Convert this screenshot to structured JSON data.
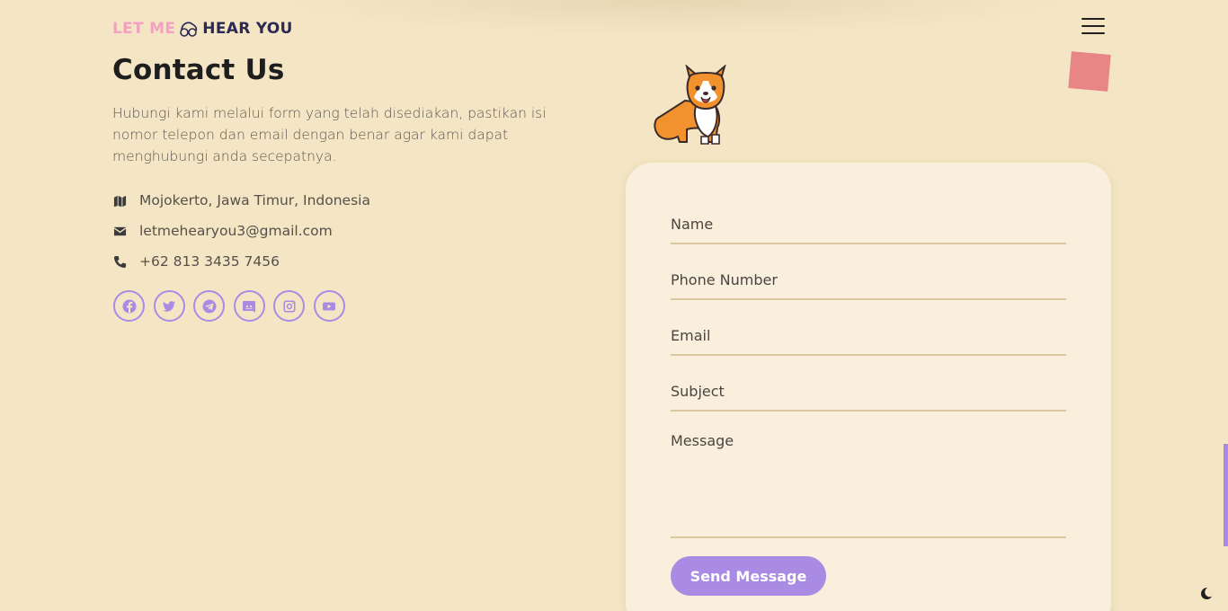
{
  "header": {
    "logo_part1": "LET ME",
    "logo_part2": "HEAR YOU",
    "menu_icon": "hamburger-menu-icon"
  },
  "contact": {
    "title": "Contact Us",
    "description": "Hubungi kami melalui form yang telah disediakan, pastikan isi nomor telepon dan email dengan benar agar kami dapat menghubungi anda secepatnya.",
    "address": "Mojokerto, Jawa Timur, Indonesia",
    "email": "letmehearyou3@gmail.com",
    "phone": "+62 813 3435 7456"
  },
  "socials": [
    "facebook-icon",
    "twitter-icon",
    "telegram-icon",
    "discord-icon",
    "instagram-icon",
    "youtube-icon"
  ],
  "form": {
    "name_label": "Name",
    "phone_label": "Phone Number",
    "email_label": "Email",
    "subject_label": "Subject",
    "message_label": "Message",
    "submit_label": "Send Message"
  },
  "colors": {
    "background": "#f4e6c4",
    "card": "#f9efdc",
    "accent": "#a98be4",
    "logo_pink": "#f3a0c2",
    "logo_navy": "#2c2a55",
    "square": "#e88585"
  }
}
